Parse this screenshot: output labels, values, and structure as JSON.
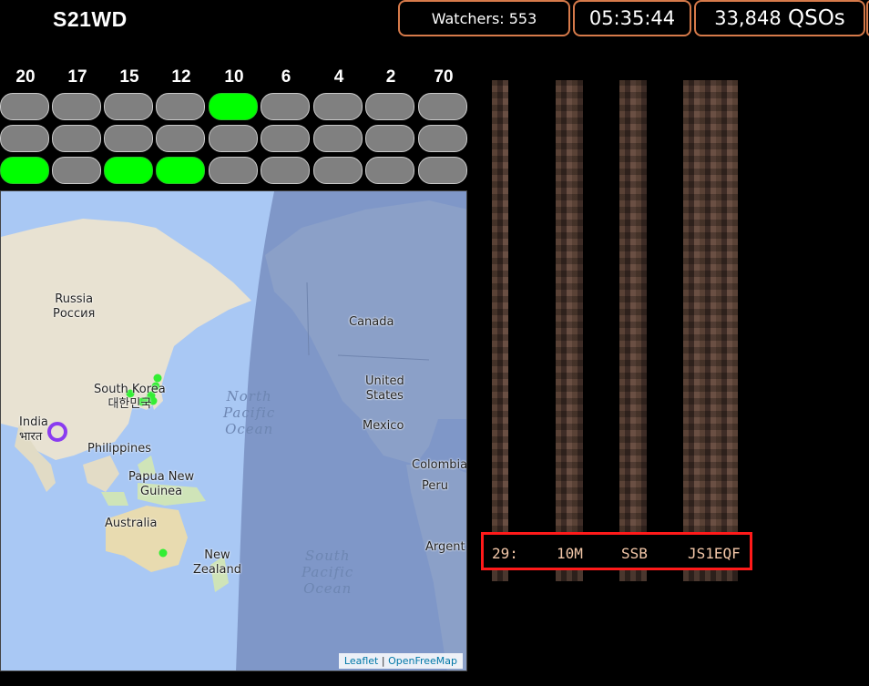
{
  "header": {
    "callsign": "S21WD",
    "watchers": "Watchers: 553",
    "clock": "05:35:44",
    "qso_count": "33,848",
    "qso_unit": "QSOs"
  },
  "bands": {
    "labels": [
      "20",
      "17",
      "15",
      "12",
      "10",
      "6",
      "4",
      "2",
      "70"
    ],
    "rows": [
      [
        false,
        false,
        false,
        false,
        true,
        false,
        false,
        false,
        false
      ],
      [
        false,
        false,
        false,
        false,
        false,
        false,
        false,
        false,
        false
      ],
      [
        true,
        false,
        true,
        true,
        false,
        false,
        false,
        false,
        false
      ]
    ],
    "on_color": "#00ff00",
    "off_color": "#808080"
  },
  "map": {
    "labels": {
      "russia": "Russia",
      "russia_local": "Россия",
      "canada": "Canada",
      "united_states": "United",
      "united_states_2": "States",
      "south_korea": "South Korea",
      "south_korea_local": "대한민국",
      "india": "India",
      "india_local": "भारत",
      "philippines": "Philippines",
      "mexico": "Mexico",
      "colombia": "Colombia",
      "peru": "Peru",
      "argentina": "Argent",
      "papua": "Papua New",
      "guinea": "Guinea",
      "australia": "Australia",
      "new_zealand": "New",
      "zealand": "Zealand",
      "north_pacific_1": "North",
      "north_pacific_2": "Pacific",
      "north_pacific_3": "Ocean",
      "south_pacific_1": "South",
      "south_pacific_2": "Pacific",
      "south_pacific_3": "Ocean"
    },
    "attribution_leaflet": "Leaflet",
    "attribution_sep": " | ",
    "attribution_ofm": "OpenFreeMap"
  },
  "log": {
    "highlight": {
      "number": "29:",
      "band": "10M",
      "mode": "SSB",
      "call": "JS1EQF"
    }
  }
}
